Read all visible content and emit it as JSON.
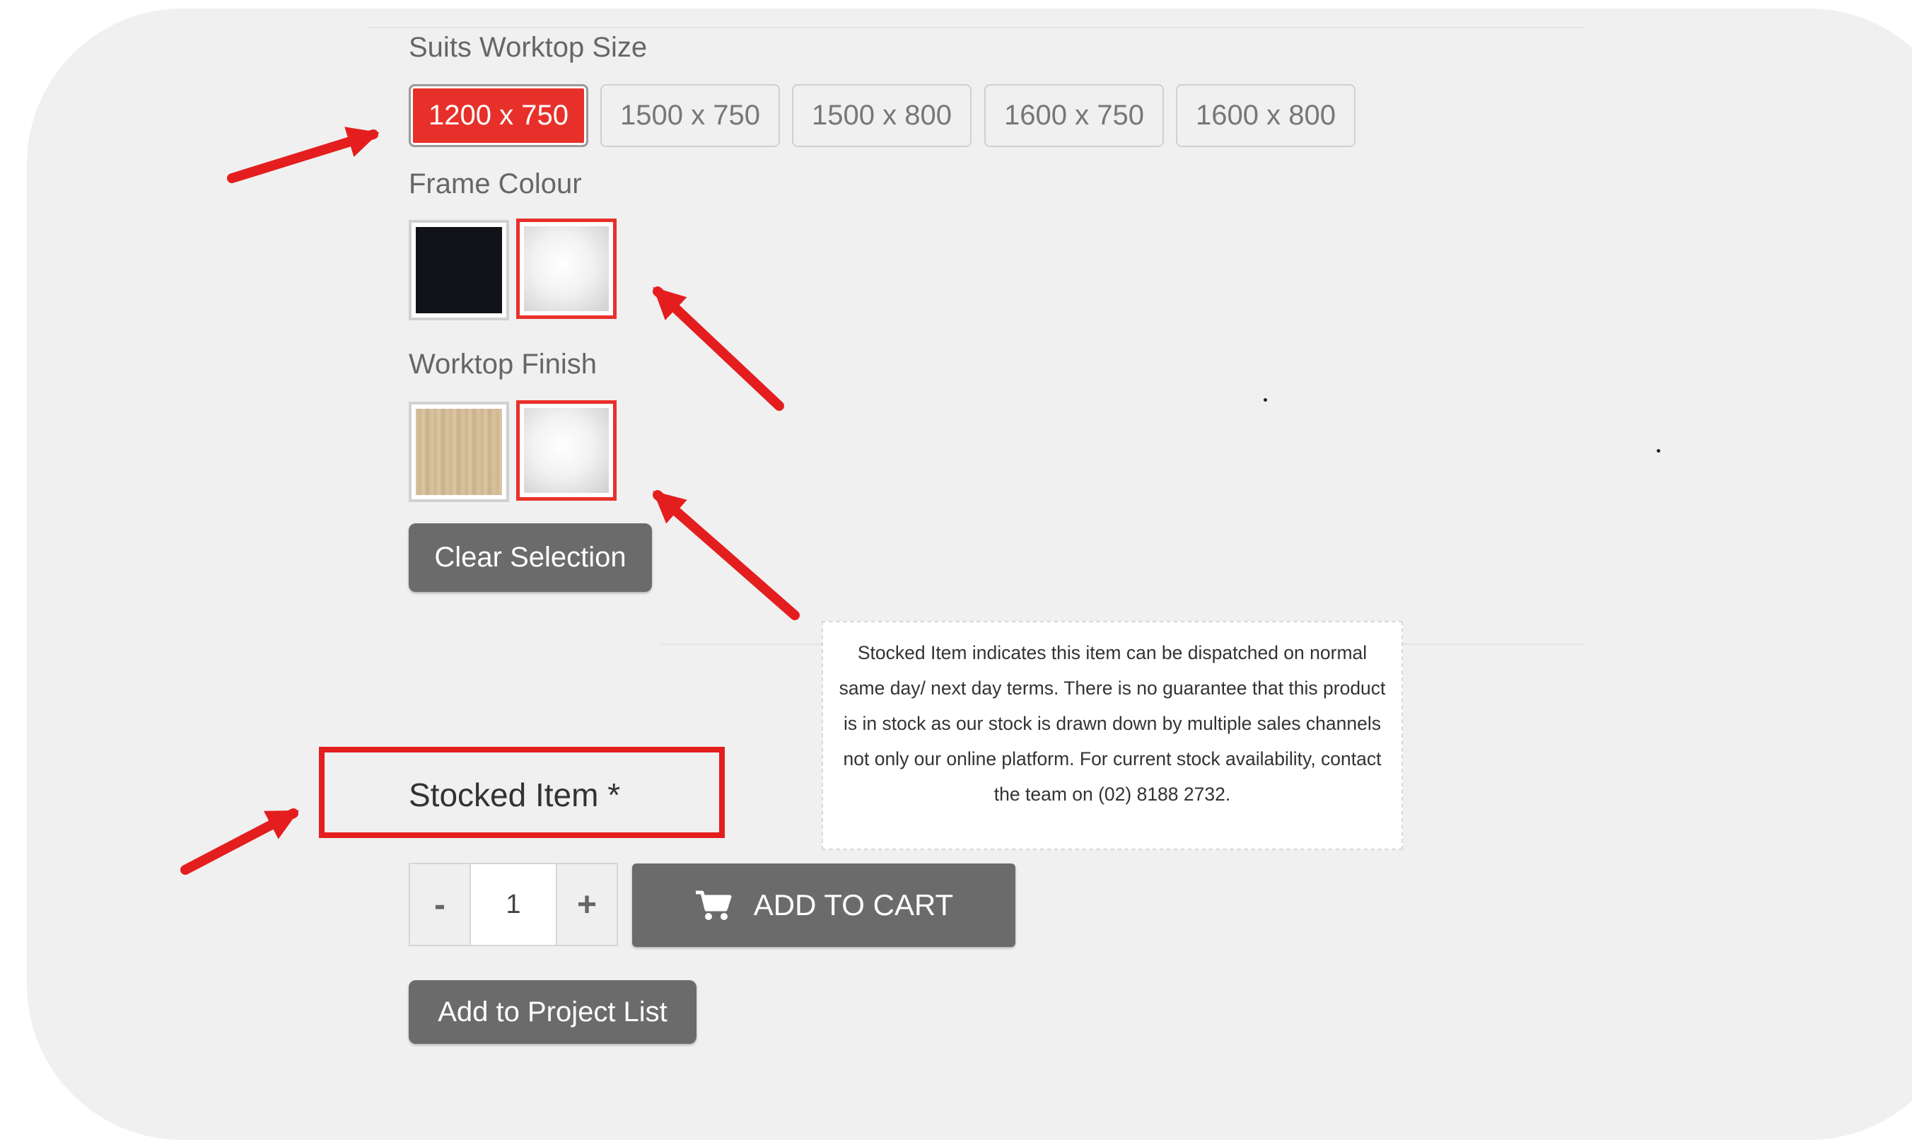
{
  "options": {
    "size_label": "Suits Worktop Size",
    "sizes": [
      "1200 x 750",
      "1500 x 750",
      "1500 x 800",
      "1600 x 750",
      "1600 x 800"
    ],
    "selected_size": "1200 x 750",
    "frame_colour_label": "Frame Colour",
    "frame_colours": [
      "black",
      "white"
    ],
    "selected_frame_colour": "white",
    "worktop_finish_label": "Worktop Finish",
    "worktop_finishes": [
      "wood",
      "white"
    ],
    "selected_worktop_finish": "white",
    "clear_label": "Clear Selection"
  },
  "stock": {
    "label": "Stocked Item *",
    "tooltip": "Stocked Item indicates this item can be dispatched on normal same day/ next day terms. There is no guarantee that this product is in stock as our stock is drawn down by multiple sales channels not only our online platform. For current stock availability, contact the team on (02) 8188 2732."
  },
  "cart": {
    "quantity": "1",
    "minus": "-",
    "plus": "+",
    "add_to_cart": "ADD TO CART",
    "add_to_project": "Add to Project List"
  },
  "colors": {
    "accent_red": "#e8302a",
    "annotation_red": "#e41e1e",
    "button_grey": "#6b6b6b",
    "panel_bg": "#f0f0f0"
  },
  "icons": {
    "cart": "cart-icon",
    "annotation": "red-arrow-icon"
  }
}
